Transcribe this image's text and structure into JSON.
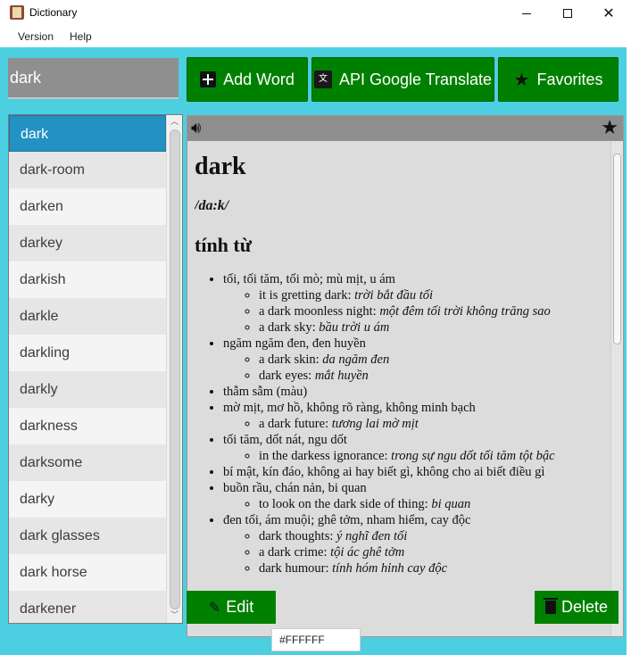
{
  "window": {
    "title": "Dictionary",
    "icon": "book-icon",
    "controls": {
      "minimize": "minimize-icon",
      "maximize": "maximize-icon",
      "close": "close-icon"
    }
  },
  "menu": [
    {
      "label": "Version"
    },
    {
      "label": "Help"
    }
  ],
  "search": {
    "value": "dark"
  },
  "toolbar": {
    "add_word": "Add Word",
    "api_translate": "API Google Translate",
    "favorites": "Favorites"
  },
  "word_list": {
    "selected": "dark",
    "items": [
      "dark",
      "dark-room",
      "darken",
      "darkey",
      "darkish",
      "darkle",
      "darkling",
      "darkly",
      "darkness",
      "darksome",
      "darky",
      "dark glasses",
      "dark horse",
      "darkener"
    ]
  },
  "definition": {
    "word": "dark",
    "pronunciation": "/da:k/",
    "part_of_speech": "tính từ",
    "senses": [
      {
        "meaning": "tối, tối tăm, tối mò; mù mịt, u ám",
        "examples": [
          {
            "en": "it is gretting dark: ",
            "vi": "trời bắt đầu tối"
          },
          {
            "en": "a dark moonless night: ",
            "vi": "một đêm tối trời không trăng sao"
          },
          {
            "en": "a dark sky: ",
            "vi": "bầu trời u ám"
          }
        ]
      },
      {
        "meaning": "ngăm ngăm đen, đen huyền",
        "examples": [
          {
            "en": "a dark skin: ",
            "vi": "da ngăm đen"
          },
          {
            "en": "dark eyes: ",
            "vi": "mắt huyền"
          }
        ]
      },
      {
        "meaning": "thẫm sẫm (màu)",
        "examples": []
      },
      {
        "meaning": "mờ mịt, mơ hồ, không rõ ràng, không minh bạch",
        "examples": [
          {
            "en": "a dark future: ",
            "vi": "tương lai mờ mịt"
          }
        ]
      },
      {
        "meaning": "tối tăm, dốt nát, ngu dốt",
        "examples": [
          {
            "en": "in the darkess ignorance: ",
            "vi": "trong sự ngu dốt tối tăm tột bậc"
          }
        ]
      },
      {
        "meaning": "bí mật, kín đáo, không ai hay biết gì, không cho ai biết điều gì",
        "examples": []
      },
      {
        "meaning": "buồn rầu, chán nản, bi quan",
        "examples": [
          {
            "en": "to look on the dark side of thing: ",
            "vi": "bi quan"
          }
        ]
      },
      {
        "meaning": "đen tối, ám muội; ghê tởm, nham hiểm, cay độc",
        "examples": [
          {
            "en": "dark thoughts: ",
            "vi": "ý nghĩ đen tối"
          },
          {
            "en": "a dark crime: ",
            "vi": "tội ác ghê tởm"
          },
          {
            "en": "dark humour: ",
            "vi": "tính hóm hỉnh cay độc"
          }
        ]
      }
    ]
  },
  "actions": {
    "edit": "Edit",
    "delete": "Delete"
  },
  "color_field": {
    "value": "#FFFFFF"
  },
  "colors": {
    "background": "#4ccfe0",
    "button": "#008000",
    "selected_item": "#2391c2",
    "panel_header": "#8e8e8e"
  }
}
